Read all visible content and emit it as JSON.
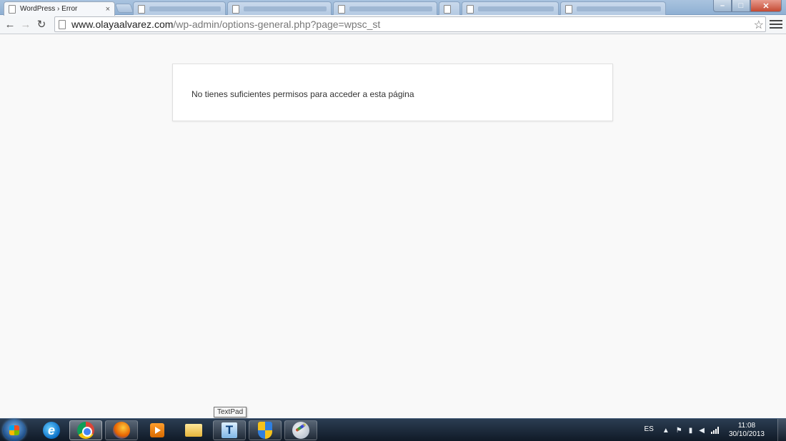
{
  "browser": {
    "tabs": [
      {
        "label": "WordPress › Error",
        "active": true
      },
      {
        "label": "",
        "active": false
      },
      {
        "label": "",
        "active": false
      },
      {
        "label": "",
        "active": false
      },
      {
        "label": "",
        "active": false
      },
      {
        "label": "",
        "active": false
      },
      {
        "label": "",
        "active": false
      }
    ],
    "close_glyph": "×",
    "url_host": "www.olayaalvarez.com",
    "url_path": "/wp-admin/options-general.php?page=wpsc_st"
  },
  "page": {
    "error_message": "No tienes suficientes permisos para acceder a esta página"
  },
  "taskbar": {
    "tooltip": "TextPad",
    "apps": [
      {
        "name": "internet-explorer",
        "state": "pinned"
      },
      {
        "name": "chrome",
        "state": "active"
      },
      {
        "name": "firefox",
        "state": "running"
      },
      {
        "name": "media-player",
        "state": "pinned"
      },
      {
        "name": "windows-explorer",
        "state": "pinned"
      },
      {
        "name": "textpad",
        "state": "running"
      },
      {
        "name": "security-shield",
        "state": "running"
      },
      {
        "name": "paint",
        "state": "running"
      }
    ],
    "tray": {
      "language": "ES",
      "time": "11:08",
      "date": "30/10/2013"
    }
  }
}
